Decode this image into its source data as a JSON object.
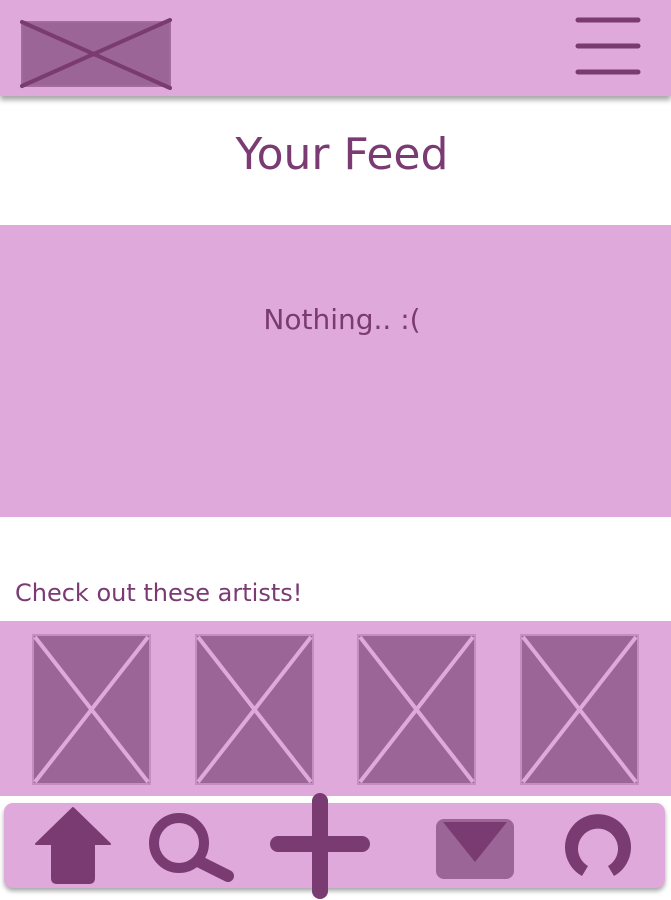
{
  "header": {
    "logo_icon": "logo-placeholder-icon",
    "menu_icon": "hamburger-menu-icon"
  },
  "feed": {
    "title": "Your Feed",
    "empty_message": "Nothing.. :("
  },
  "artists": {
    "heading": "Check out these artists!",
    "cards": [
      {
        "icon": "image-placeholder-icon"
      },
      {
        "icon": "image-placeholder-icon"
      },
      {
        "icon": "image-placeholder-icon"
      },
      {
        "icon": "image-placeholder-icon"
      }
    ]
  },
  "bottom_nav": {
    "items": [
      {
        "icon": "home-icon"
      },
      {
        "icon": "search-icon"
      },
      {
        "icon": "plus-icon"
      },
      {
        "icon": "mail-icon"
      },
      {
        "icon": "profile-icon"
      }
    ]
  },
  "colors": {
    "accent_light": "#dfa9db",
    "accent_dark": "#7a3a72",
    "placeholder_fill": "#9c6597",
    "background": "#ffffff"
  }
}
